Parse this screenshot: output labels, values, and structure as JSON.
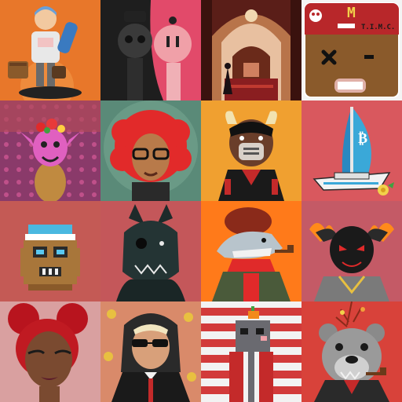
{
  "grid": {
    "tiles": [
      {
        "name": "skater-kid-toy",
        "bg": "#e8772a"
      },
      {
        "name": "bw-pink-robots",
        "bg": "#2a2a2a"
      },
      {
        "name": "palace-interior",
        "bg": "#6e2a20"
      },
      {
        "name": "brown-card-face",
        "bg": "#8a5a2b"
      },
      {
        "name": "pink-devil-flowers",
        "bg": "#7a3a60"
      },
      {
        "name": "red-afro-woman",
        "bg": "#55806e"
      },
      {
        "name": "bull-masked-man",
        "bg": "#f0a030"
      },
      {
        "name": "bitcoin-yacht",
        "bg": "#d9585e"
      },
      {
        "name": "pixel-potato-cap",
        "bg": "#c45a55"
      },
      {
        "name": "black-wolf",
        "bg": "#c4575a"
      },
      {
        "name": "shark-jacket-pipe",
        "bg": "#ff7a1a"
      },
      {
        "name": "black-demon-fire",
        "bg": "#c45a66"
      },
      {
        "name": "red-bun-girl",
        "bg": "#d9a0a0"
      },
      {
        "name": "sunglasses-suit-man",
        "bg": "#d98a6a"
      },
      {
        "name": "pixel-rat-pumpkin",
        "bg": "#d23a3a"
      },
      {
        "name": "grey-bear-pipe",
        "bg": "#d8423a"
      }
    ]
  },
  "card": {
    "letter": "M",
    "label": "T.I.M.C."
  },
  "yacht": {
    "sail_symbol": "₿"
  }
}
